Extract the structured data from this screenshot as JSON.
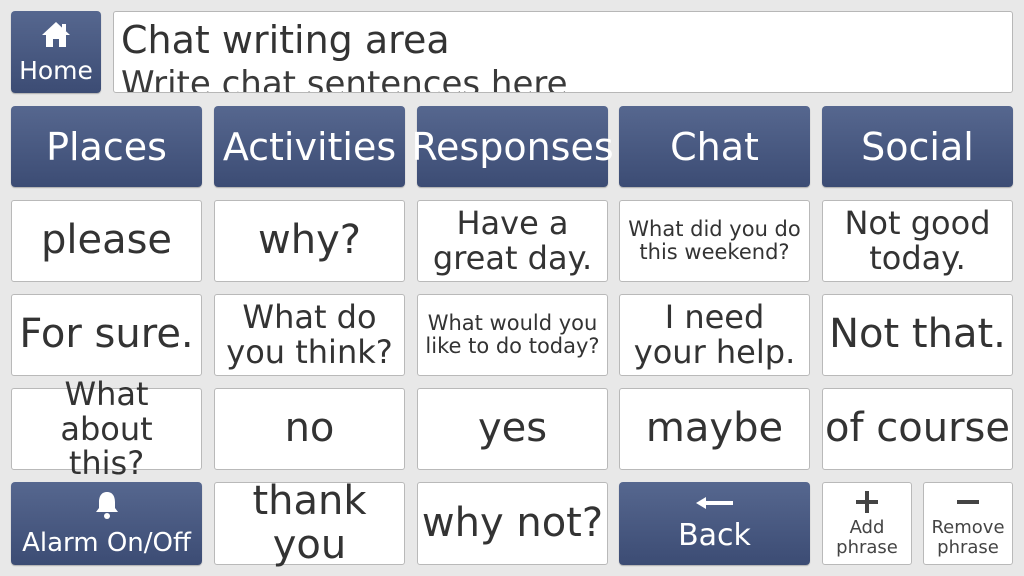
{
  "home": {
    "label": "Home",
    "icon": "home-icon"
  },
  "chat_area": {
    "title": "Chat writing area",
    "placeholder": "Write chat sentences here"
  },
  "categories": [
    {
      "label": "Places"
    },
    {
      "label": "Activities"
    },
    {
      "label": "Responses"
    },
    {
      "label": "Chat"
    },
    {
      "label": "Social"
    }
  ],
  "phrases": {
    "row1": [
      "please",
      "why?",
      "Have a great day.",
      "What did you do this weekend?",
      "Not good today."
    ],
    "row2": [
      "For sure.",
      "What do you think?",
      "What would you like to do today?",
      "I need your help.",
      "Not that."
    ],
    "row3": [
      "What about this?",
      "no",
      "yes",
      "maybe",
      "of course"
    ],
    "row4": [
      "thank you",
      "why not?"
    ]
  },
  "controls": {
    "alarm": {
      "label": "Alarm On/Off",
      "icon": "bell-icon"
    },
    "back": {
      "label": "Back",
      "icon": "arrow-left-icon"
    },
    "add_phrase": {
      "label": "Add phrase",
      "icon": "plus-icon"
    },
    "remove_phrase": {
      "label": "Remove phrase",
      "icon": "minus-icon"
    }
  },
  "colors": {
    "navy_top": "#56678f",
    "navy_bottom": "#3c4c74",
    "tile_bg": "#ffffff",
    "page_bg": "#e8e8e8"
  }
}
